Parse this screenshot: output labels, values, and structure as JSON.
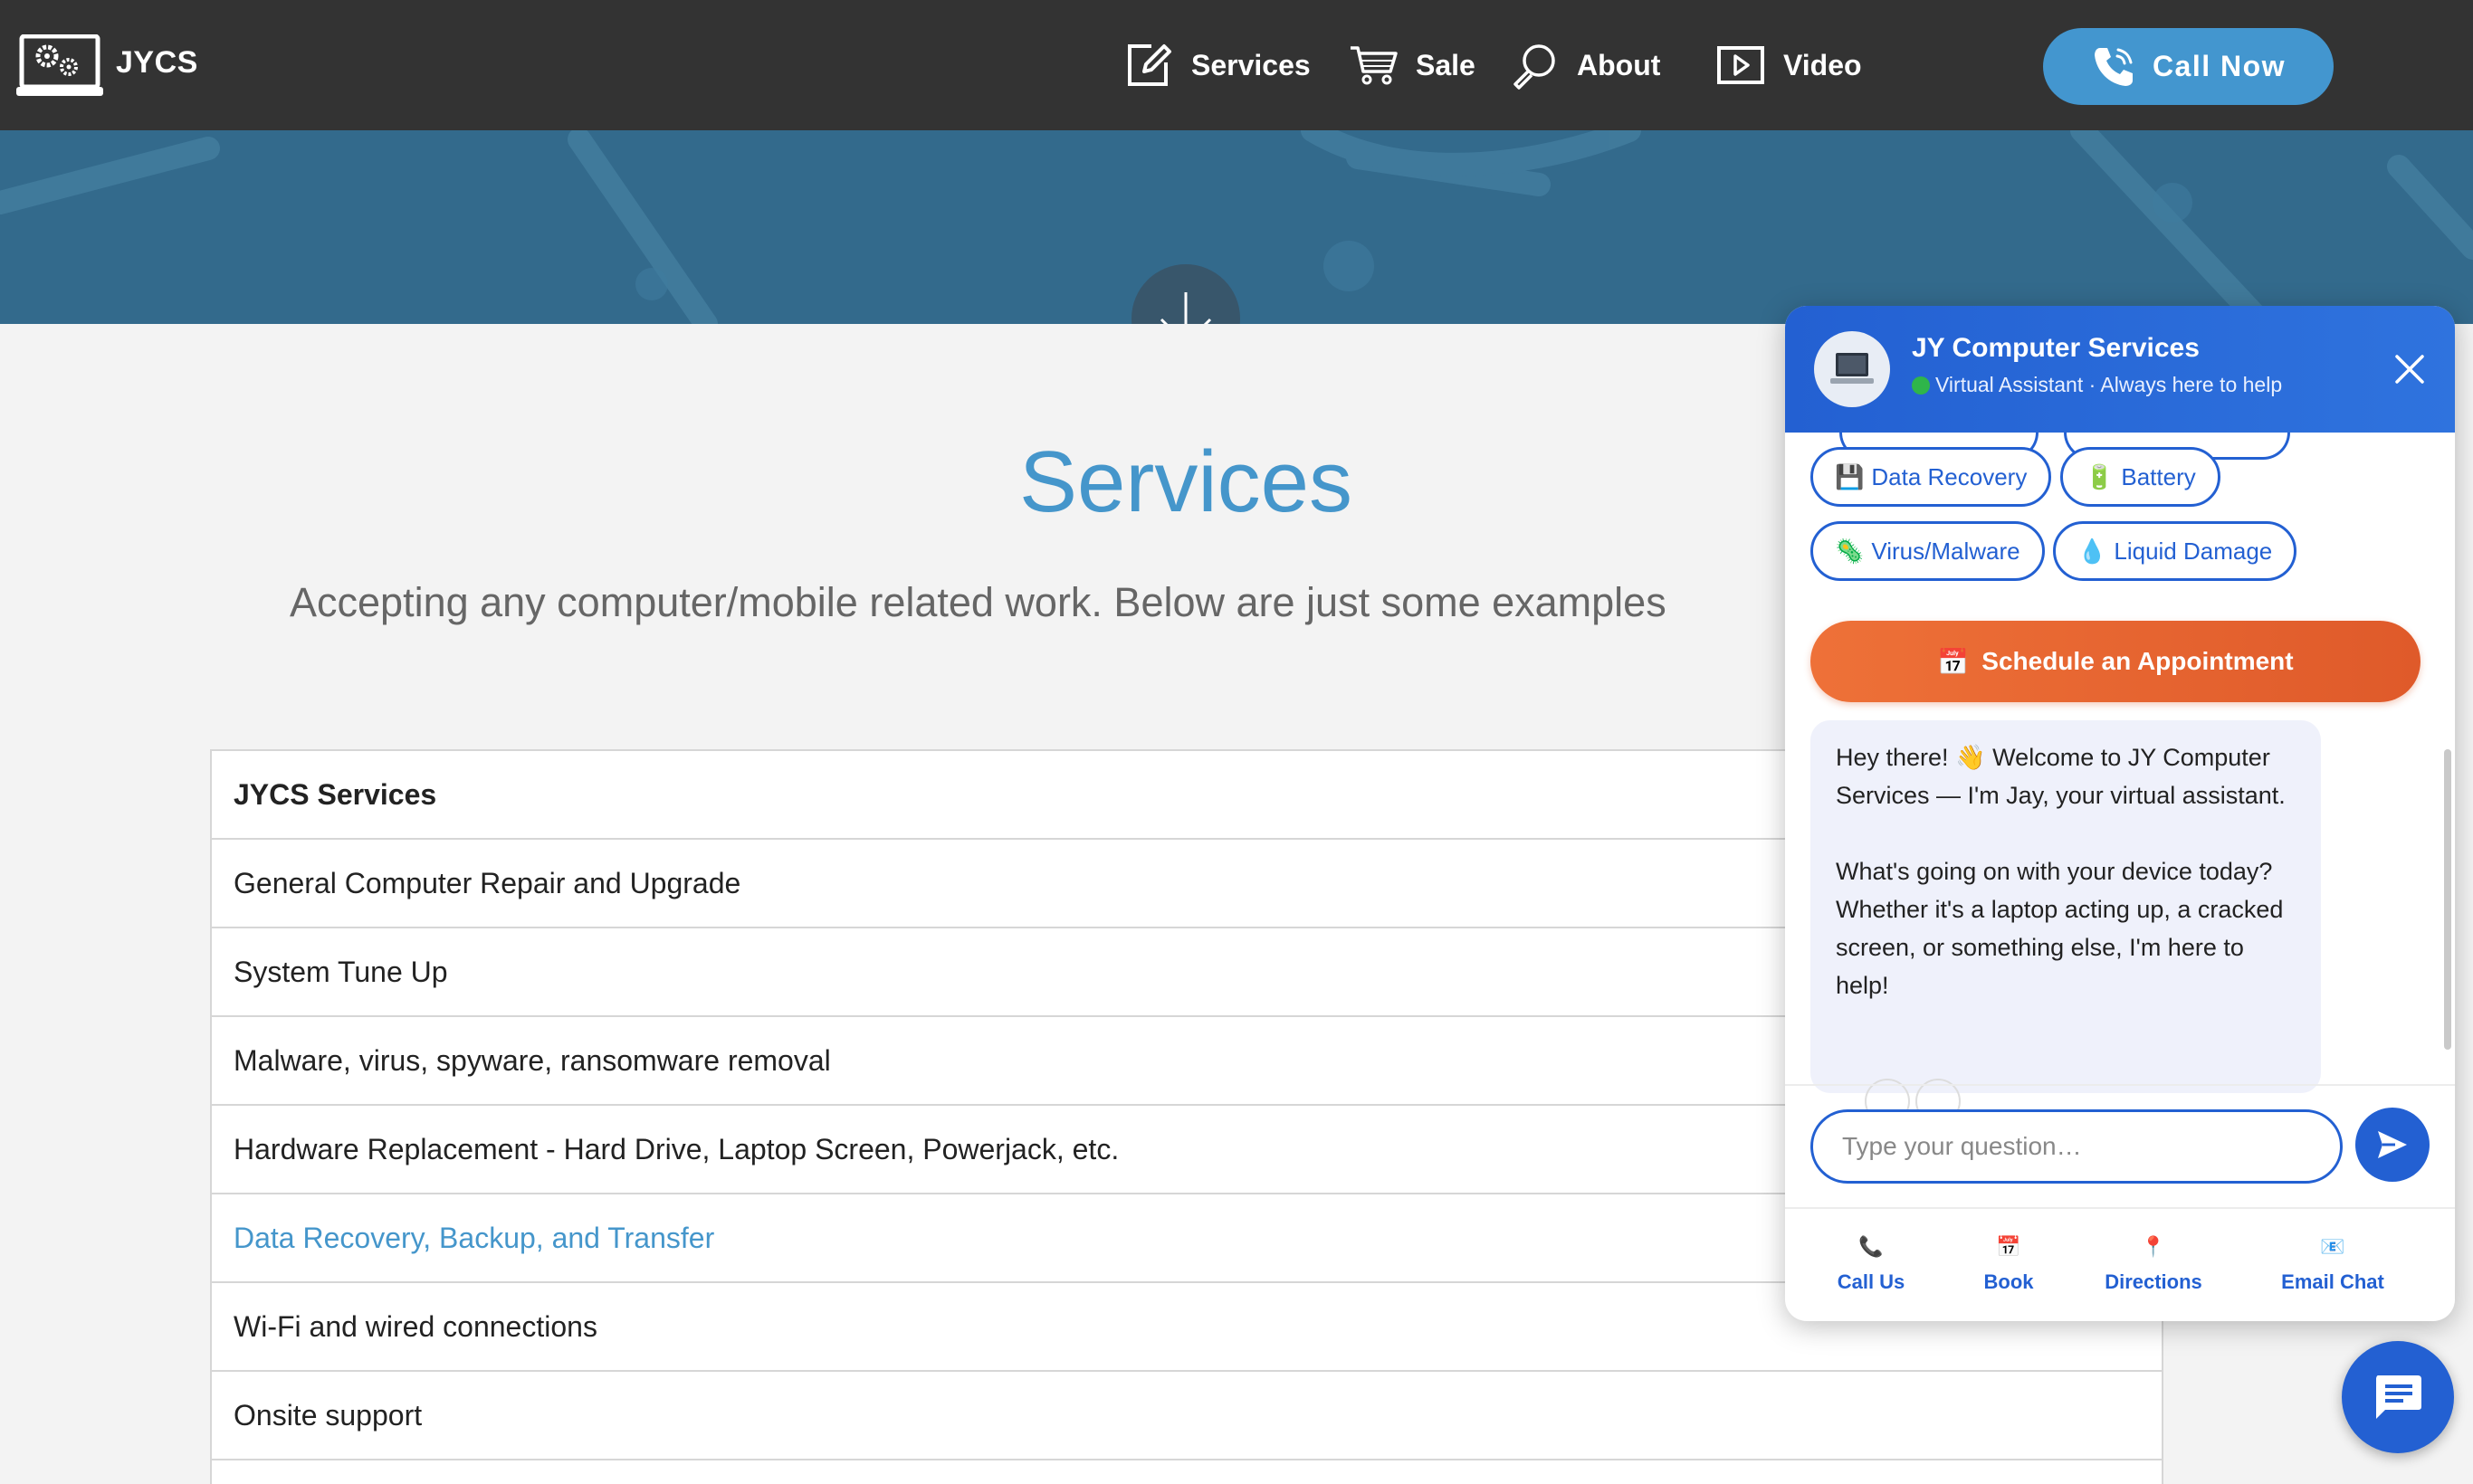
{
  "brand": {
    "name": "JYCS",
    "icon": "laptop-gears-icon"
  },
  "nav": {
    "items": [
      {
        "label": "Services",
        "icon": "edit-icon"
      },
      {
        "label": "Sale",
        "icon": "cart-icon"
      },
      {
        "label": "About",
        "icon": "magnifier-icon"
      },
      {
        "label": "Video",
        "icon": "play-icon"
      }
    ],
    "call_label": "Call Now",
    "call_icon": "phone-icon"
  },
  "hero": {
    "scroll_icon": "arrow-down-icon"
  },
  "page": {
    "title": "Services",
    "subtitle": "Accepting any computer/mobile related work. Below are just some examples"
  },
  "services_table": {
    "header": "JYCS Services",
    "rows": [
      "General Computer Repair and Upgrade",
      "System Tune Up",
      "Malware, virus, spyware, ransomware removal",
      "Hardware Replacement - Hard Drive, Laptop Screen, Powerjack, etc.",
      "Data Recovery, Backup, and Transfer",
      "Wi-Fi and wired connections",
      "Onsite support"
    ],
    "link_color": "#4596cb"
  },
  "chat": {
    "name": "JY Computer Services",
    "status": "Virtual Assistant · Always here to help",
    "accent": "#2360d2",
    "chips": [
      {
        "label": "Data Recovery",
        "emoji": "💾"
      },
      {
        "label": "Battery",
        "emoji": "🔋"
      },
      {
        "label": "Virus/Malware",
        "emoji": "🦠"
      },
      {
        "label": "Liquid Damage",
        "emoji": "💧"
      }
    ],
    "schedule_label": "Schedule an Appointment",
    "schedule_emoji": "📅",
    "message_p1": "Hey there! 👋 Welcome to JY Computer Services — I'm Jay, your virtual assistant.",
    "message_p2": "What's going on with your device today? Whether it's a laptop acting up, a cracked screen, or something else, I'm here to help!",
    "input_placeholder": "Type your question…",
    "footer": [
      {
        "label": "Call Us",
        "emoji": "📞"
      },
      {
        "label": "Book",
        "emoji": "📅"
      },
      {
        "label": "Directions",
        "emoji": "📍"
      },
      {
        "label": "Email Chat",
        "emoji": "📧"
      }
    ]
  }
}
